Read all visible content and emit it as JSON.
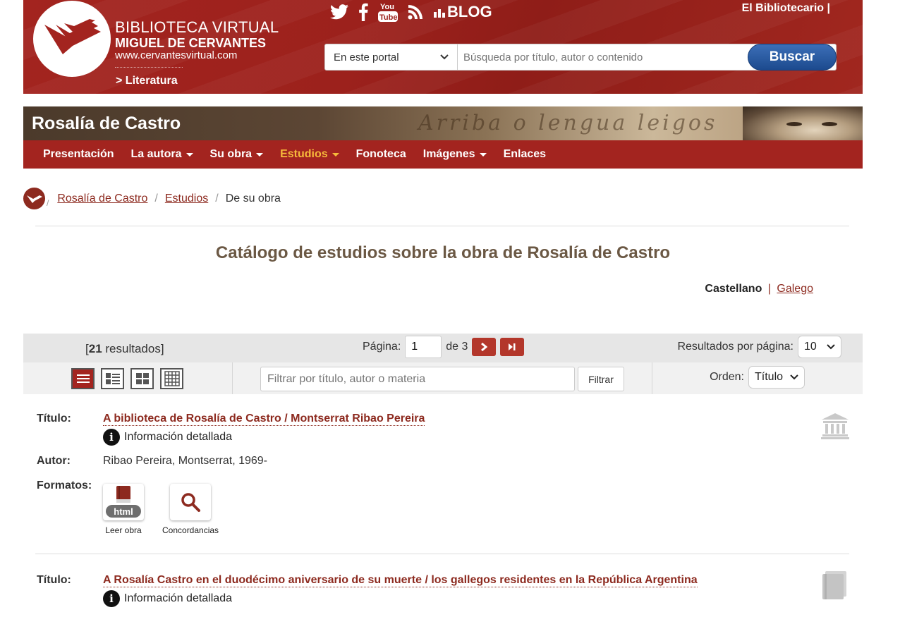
{
  "header": {
    "logo": {
      "line1": "BIBLIOTECA VIRTUAL",
      "line2": "MIGUEL DE CERVANTES",
      "line3": "www.cervantesvirtual.com"
    },
    "section_link": "> Literatura",
    "social": [
      "twitter-icon",
      "facebook-icon",
      "youtube-icon",
      "rss-icon"
    ],
    "blog_label": "BLOG",
    "user_link": "El Bibliotecario  |",
    "search": {
      "scope": "En este portal",
      "placeholder": "Búsqueda por título, autor o contenido",
      "button": "Buscar"
    }
  },
  "banner": {
    "title": "Rosalía de Castro",
    "script_text": "Arriba o lengua leigos"
  },
  "nav": [
    {
      "label": "Presentación",
      "dropdown": false,
      "active": false
    },
    {
      "label": "La autora",
      "dropdown": true,
      "active": false
    },
    {
      "label": "Su obra",
      "dropdown": true,
      "active": false
    },
    {
      "label": "Estudios",
      "dropdown": true,
      "active": true
    },
    {
      "label": "Fonoteca",
      "dropdown": false,
      "active": false
    },
    {
      "label": "Imágenes",
      "dropdown": true,
      "active": false
    },
    {
      "label": "Enlaces",
      "dropdown": false,
      "active": false
    }
  ],
  "breadcrumb": {
    "sep": "/",
    "items": [
      "Rosalía de Castro",
      "Estudios"
    ],
    "current": "De su obra"
  },
  "page_title": "Catálogo de estudios sobre la obra de Rosalía de Castro",
  "language": {
    "current": "Castellano",
    "sep": "|",
    "other": "Galego"
  },
  "results": {
    "open": "[",
    "count": "21",
    "label": " resultados]",
    "page_label": "Página:",
    "page_value": "1",
    "of_label": "de 3",
    "per_page_label": "Resultados por página:",
    "per_page_value": "10",
    "filter_placeholder": "Filtrar por título, autor o materia",
    "filter_button": "Filtrar",
    "order_label": "Orden:",
    "order_value": "Título"
  },
  "labels": {
    "title": "Título:",
    "author": "Autor:",
    "formats": "Formatos:",
    "info": "Información detallada"
  },
  "records": [
    {
      "title": "A biblioteca de Rosalía de Castro / Montserrat Ribao Pereira",
      "author": "Ribao Pereira, Montserrat, 1969-",
      "formats": [
        {
          "label": "Leer obra",
          "badge": "html",
          "icon": "book-icon"
        },
        {
          "label": "Concordancias",
          "icon": "magnifier-icon"
        }
      ],
      "side_icon": "institution-icon"
    },
    {
      "title": "A Rosalía Castro en el duodécimo aniversario de su muerte / los gallegos residentes en la República Argentina",
      "side_icon": "book-stack-icon"
    }
  ],
  "colors": {
    "brand_red": "#a3241f",
    "link_red": "#8d2a1f",
    "active_nav": "#f6b93b",
    "search_blue": "#1c4a8e",
    "title_brown": "#6b5844"
  }
}
